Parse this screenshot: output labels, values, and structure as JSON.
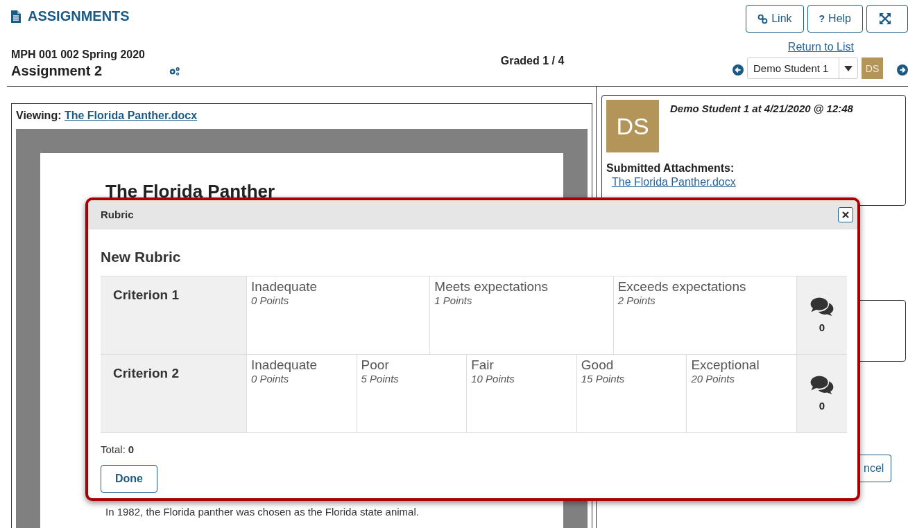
{
  "header": {
    "title": "ASSIGNMENTS",
    "buttons": [
      {
        "kind": "link",
        "label": "Link"
      },
      {
        "kind": "help",
        "icon_text": "?",
        "label": "Help"
      },
      {
        "kind": "fullscreen"
      }
    ]
  },
  "grading": {
    "course": "MPH 001 002 Spring 2020",
    "assignment": "Assignment 2",
    "graded": "Graded 1 / 4",
    "return_link": "Return to List",
    "student_select": {
      "value": "Demo Student 1"
    },
    "avatar_initials": "DS"
  },
  "viewer": {
    "label": "Viewing:",
    "file_link": "The Florida Panther.docx",
    "document": {
      "heading": "The Florida Panther",
      "paragraph": "In 1982, the Florida panther was chosen as the Florida state animal."
    }
  },
  "submission": {
    "avatar_initials": "DS",
    "meta": "Demo Student 1 at 4/21/2020 @ 12:48",
    "attachments_label": "Submitted Attachments:",
    "attachment": "The Florida Panther.docx"
  },
  "cancel_button": {
    "label": "ncel"
  },
  "rubric_dialog": {
    "title": "Rubric",
    "rubric_name": "New Rubric",
    "criteria": [
      {
        "name": "Criterion 1",
        "levels": [
          {
            "title": "Inadequate",
            "points": "0 Points"
          },
          {
            "title": "Meets expectations",
            "points": "1 Points"
          },
          {
            "title": "Exceeds expectations",
            "points": "2 Points"
          }
        ],
        "comment_count": "0"
      },
      {
        "name": "Criterion 2",
        "levels": [
          {
            "title": "Inadequate",
            "points": "0 Points"
          },
          {
            "title": "Poor",
            "points": "5 Points"
          },
          {
            "title": "Fair",
            "points": "10 Points"
          },
          {
            "title": "Good",
            "points": "15 Points"
          },
          {
            "title": "Exceptional",
            "points": "20 Points"
          }
        ],
        "comment_count": "0"
      }
    ],
    "total_label": "Total:",
    "total": "0",
    "done": "Done"
  }
}
